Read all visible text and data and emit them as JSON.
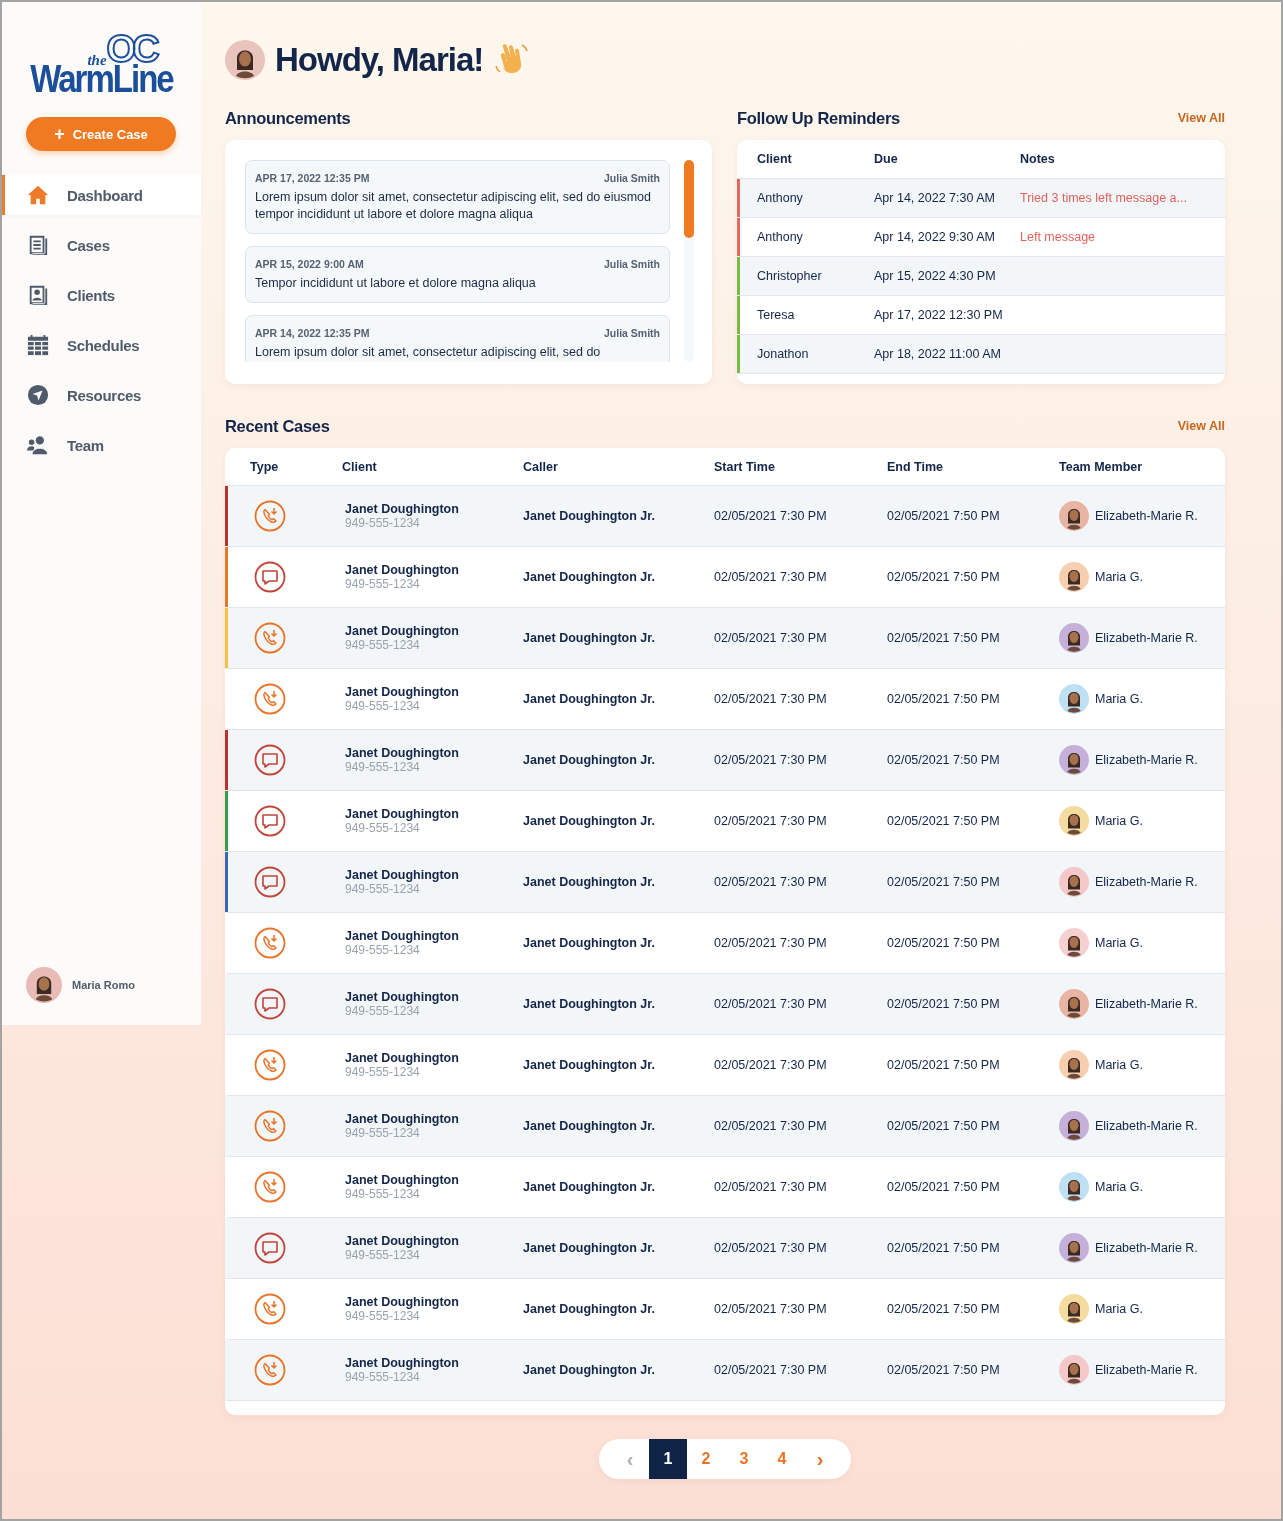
{
  "logo": {
    "tagline": "the",
    "initials": "OC",
    "wordmark": "WarmLine"
  },
  "create_button": {
    "label": "Create Case",
    "icon": "+"
  },
  "nav": [
    {
      "label": "Dashboard",
      "kind": "home",
      "selected": true
    },
    {
      "label": "Cases",
      "kind": "cases",
      "selected": false
    },
    {
      "label": "Clients",
      "kind": "clients",
      "selected": false
    },
    {
      "label": "Schedules",
      "kind": "schedules",
      "selected": false
    },
    {
      "label": "Resources",
      "kind": "resources",
      "selected": false
    },
    {
      "label": "Team",
      "kind": "team",
      "selected": false
    }
  ],
  "user": {
    "name": "Maria Romo"
  },
  "greeting": {
    "text": "Howdy, Maria!"
  },
  "announcements": {
    "title": "Announcements",
    "items": [
      {
        "date": "APR 17, 2022 12:35 PM",
        "author": "Julia Smith",
        "text": "Lorem ipsum dolor sit amet, consectetur adipiscing elit, sed do eiusmod tempor incididunt ut labore et dolore magna aliqua"
      },
      {
        "date": "APR 15, 2022 9:00 AM",
        "author": "Julia Smith",
        "text": "Tempor incididunt ut labore et dolore magna aliqua"
      },
      {
        "date": "APR 14, 2022 12:35 PM",
        "author": "Julia Smith",
        "text": "Lorem ipsum dolor sit amet, consectetur adipiscing elit, sed do"
      }
    ]
  },
  "reminders": {
    "title": "Follow Up Reminders",
    "view_all": "View All",
    "columns": [
      "Client",
      "Due",
      "Notes"
    ],
    "rows": [
      {
        "client": "Anthony",
        "due": "Apr 14, 2022 7:30 AM",
        "notes": "Tried 3 times left message a...",
        "color": "#e06a5e"
      },
      {
        "client": "Anthony",
        "due": "Apr 14, 2022 9:30 AM",
        "notes": "Left message",
        "color": "#e06a5e"
      },
      {
        "client": "Christopher",
        "due": "Apr 15, 2022 4:30 PM",
        "color": "#7cba48"
      },
      {
        "client": "Teresa",
        "due": "Apr 17, 2022 12:30 PM",
        "color": "#7cba48"
      },
      {
        "client": "Jonathon",
        "due": "Apr 18, 2022 11:00 AM",
        "color": "#7cba48"
      }
    ]
  },
  "recent_cases": {
    "title": "Recent Cases",
    "view_all": "View All",
    "columns": [
      "Type",
      "Client",
      "Caller",
      "Start Time",
      "End Time",
      "Team Member"
    ],
    "rows": [
      {
        "kind": "call",
        "color": "#b8332f",
        "client": "Janet Doughington",
        "phone": "949-555-1234",
        "caller": "Janet Doughington Jr.",
        "start": "02/05/2021 7:30 PM",
        "end": "02/05/2021 7:50 PM",
        "member": "Elizabeth-Marie R."
      },
      {
        "kind": "chat",
        "color": "#e07a2c",
        "client": "Janet Doughington",
        "phone": "949-555-1234",
        "caller": "Janet Doughington Jr.",
        "start": "02/05/2021 7:30 PM",
        "end": "02/05/2021 7:50 PM",
        "member": "Maria G."
      },
      {
        "kind": "call",
        "color": "#f4c143",
        "client": "Janet Doughington",
        "phone": "949-555-1234",
        "caller": "Janet Doughington Jr.",
        "start": "02/05/2021 7:30 PM",
        "end": "02/05/2021 7:50 PM",
        "member": "Elizabeth-Marie R."
      },
      {
        "kind": "call",
        "client": "Janet Doughington",
        "phone": "949-555-1234",
        "caller": "Janet Doughington Jr.",
        "start": "02/05/2021 7:30 PM",
        "end": "02/05/2021 7:50 PM",
        "member": "Maria G."
      },
      {
        "kind": "chat",
        "color": "#b8332f",
        "client": "Janet Doughington",
        "phone": "949-555-1234",
        "caller": "Janet Doughington Jr.",
        "start": "02/05/2021 7:30 PM",
        "end": "02/05/2021 7:50 PM",
        "member": "Elizabeth-Marie R."
      },
      {
        "kind": "chat",
        "color": "#3a9a4c",
        "client": "Janet Doughington",
        "phone": "949-555-1234",
        "caller": "Janet Doughington Jr.",
        "start": "02/05/2021 7:30 PM",
        "end": "02/05/2021 7:50 PM",
        "member": "Maria G."
      },
      {
        "kind": "chat",
        "color": "#3a66b4",
        "client": "Janet Doughington",
        "phone": "949-555-1234",
        "caller": "Janet Doughington Jr.",
        "start": "02/05/2021 7:30 PM",
        "end": "02/05/2021 7:50 PM",
        "member": "Elizabeth-Marie R."
      },
      {
        "kind": "call",
        "client": "Janet Doughington",
        "phone": "949-555-1234",
        "caller": "Janet Doughington Jr.",
        "start": "02/05/2021 7:30 PM",
        "end": "02/05/2021 7:50 PM",
        "member": "Maria G."
      },
      {
        "kind": "chat",
        "client": "Janet Doughington",
        "phone": "949-555-1234",
        "caller": "Janet Doughington Jr.",
        "start": "02/05/2021 7:30 PM",
        "end": "02/05/2021 7:50 PM",
        "member": "Elizabeth-Marie R."
      },
      {
        "kind": "call",
        "client": "Janet Doughington",
        "phone": "949-555-1234",
        "caller": "Janet Doughington Jr.",
        "start": "02/05/2021 7:30 PM",
        "end": "02/05/2021 7:50 PM",
        "member": "Maria G."
      },
      {
        "kind": "call",
        "client": "Janet Doughington",
        "phone": "949-555-1234",
        "caller": "Janet Doughington Jr.",
        "start": "02/05/2021 7:30 PM",
        "end": "02/05/2021 7:50 PM",
        "member": "Elizabeth-Marie R."
      },
      {
        "kind": "call",
        "client": "Janet Doughington",
        "phone": "949-555-1234",
        "caller": "Janet Doughington Jr.",
        "start": "02/05/2021 7:30 PM",
        "end": "02/05/2021 7:50 PM",
        "member": "Maria G."
      },
      {
        "kind": "chat",
        "client": "Janet Doughington",
        "phone": "949-555-1234",
        "caller": "Janet Doughington Jr.",
        "start": "02/05/2021 7:30 PM",
        "end": "02/05/2021 7:50 PM",
        "member": "Elizabeth-Marie R."
      },
      {
        "kind": "call",
        "client": "Janet Doughington",
        "phone": "949-555-1234",
        "caller": "Janet Doughington Jr.",
        "start": "02/05/2021 7:30 PM",
        "end": "02/05/2021 7:50 PM",
        "member": "Maria G."
      },
      {
        "kind": "call",
        "client": "Janet Doughington",
        "phone": "949-555-1234",
        "caller": "Janet Doughington Jr.",
        "start": "02/05/2021 7:30 PM",
        "end": "02/05/2021 7:50 PM",
        "member": "Elizabeth-Marie R."
      }
    ]
  },
  "pagination": {
    "prev": {
      "label": "‹",
      "disabled": true
    },
    "pages": [
      {
        "label": "1",
        "selected": true
      },
      {
        "label": "2",
        "selected": false
      },
      {
        "label": "3",
        "selected": false
      },
      {
        "label": "4",
        "selected": false
      }
    ],
    "next": {
      "label": "›",
      "disabled": false
    }
  }
}
